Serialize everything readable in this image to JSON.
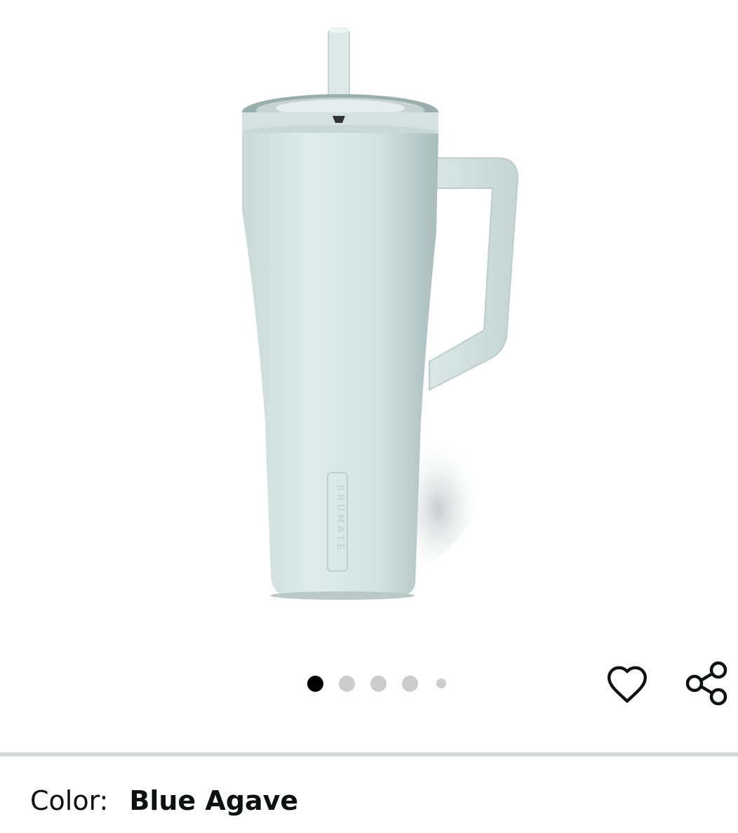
{
  "product": {
    "image_alt": "BrüMate tumbler with handle and straw",
    "brand_mark": "BRŰMATE"
  },
  "carousel": {
    "total_images": 5,
    "active_index": 0
  },
  "actions": {
    "wishlist_icon": "heart-icon",
    "share_icon": "share-icon"
  },
  "variant": {
    "color_label": "Color:",
    "color_value": "Blue Agave"
  },
  "colors": {
    "tumbler_body": "#d9e6e5",
    "tumbler_shadow": "#b9c9c8",
    "dot_active": "#000000",
    "dot_inactive": "#cccccc",
    "divider": "#d5d9d9",
    "text": "#0f1111"
  }
}
